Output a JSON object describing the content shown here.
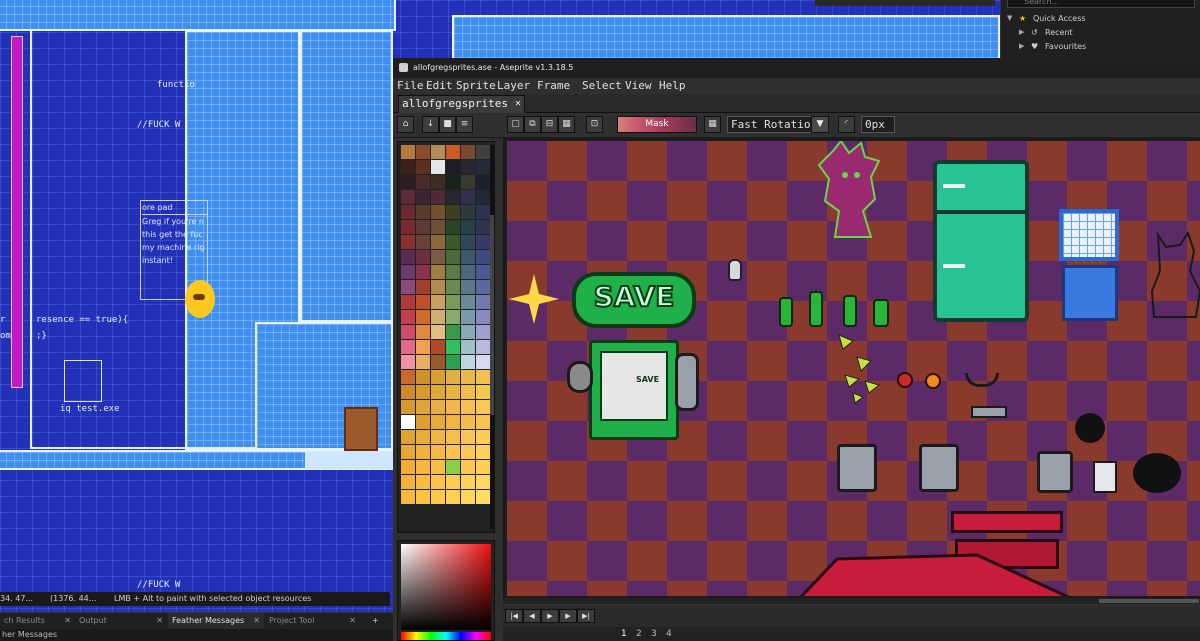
{
  "gm_room": {
    "code_fragments": [
      "functio",
      "//FUCK W",
      "resence == true){",
      ";}",
      "om",
      "r",
      "//FUCK W"
    ],
    "notepad": {
      "title": "ore pad",
      "lines": [
        "Greg if you're n",
        "this get the fuc",
        "my machine rig",
        "instant!"
      ]
    },
    "file_label": "iq test.exe",
    "colors": {
      "background": "#2231b8",
      "wall": "#3e8ff0",
      "outline": "#e8f2ff"
    }
  },
  "gm_status": {
    "coord1": "34. 47...",
    "coord2": "(1376. 44...",
    "hint": "LMB + Alt to paint with selected object resources"
  },
  "gm_tabs": [
    {
      "label": "ch Results",
      "close": "✕",
      "active": false
    },
    {
      "label": "Output",
      "close": "✕",
      "active": false
    },
    {
      "label": "Feather Messages",
      "close": "✕",
      "active": true
    },
    {
      "label": "Project Tool",
      "close": "✕",
      "active": false
    }
  ],
  "gm_tab_add": "+",
  "gm_feather_label": "her Messages",
  "gm_right": {
    "search_placeholder": "Search...",
    "items": [
      {
        "label": "Quick Access",
        "icon": "star-icon"
      },
      {
        "label": "Recent",
        "icon": "history-icon"
      },
      {
        "label": "Favourites",
        "icon": "heart-icon"
      }
    ]
  },
  "aseprite": {
    "title": "allofgregsprites.ase - Aseprite v1.3.18.5",
    "menu": [
      "File",
      "Edit",
      "Sprite",
      "Layer",
      "Frame",
      "Select",
      "View",
      "Help"
    ],
    "tab": {
      "label": "allofgregsprites",
      "close": "✕"
    },
    "toolbar": {
      "mask_label": "Mask",
      "rotation_algorithm": "Fast Rotation",
      "tolerance": "0px"
    },
    "timeline": {
      "buttons": [
        "|◀",
        "◀",
        "▶",
        "▶",
        "▶|"
      ],
      "frames": [
        "1",
        "2",
        "3",
        "4"
      ],
      "active_frame": "1"
    },
    "palette": [
      "#b37a3b",
      "#8d4b2e",
      "#b58a5c",
      "#c85c26",
      "#7a4a2c",
      "#404040",
      "#3a2016",
      "#5a3020",
      "#e6e6e6",
      "#1d1d28",
      "#2a2533",
      "#262b3c",
      "#2e1d20",
      "#4a2a2a",
      "#3c2e22",
      "#142418",
      "#3a3a30",
      "#1e2030",
      "#5a2a38",
      "#3e2430",
      "#502a34",
      "#2a2630",
      "#33304a",
      "#222a3a",
      "#6a2a2e",
      "#5a3c2c",
      "#74502c",
      "#3a4020",
      "#2a3a3e",
      "#2c3450",
      "#7a2a2c",
      "#5e3a36",
      "#6e5034",
      "#2a442a",
      "#28404a",
      "#2f3450",
      "#8a3030",
      "#6a4038",
      "#8a6a3a",
      "#3a5a2c",
      "#2e4a5a",
      "#3a3a6a",
      "#5a2a50",
      "#6a3040",
      "#7c5a48",
      "#4a6a3a",
      "#3a5a6a",
      "#3e4a80",
      "#6a3a6a",
      "#8a3050",
      "#a08040",
      "#5a7a44",
      "#4a6a7a",
      "#4a5a96",
      "#8a4a7a",
      "#a0402c",
      "#b08a50",
      "#6a8a50",
      "#5a7a8a",
      "#5a6aa0",
      "#b03a3a",
      "#c0502a",
      "#c8a060",
      "#7a9a5a",
      "#6a8a9a",
      "#707ab0",
      "#c04050",
      "#d06a30",
      "#d0b070",
      "#8aaa6a",
      "#7a9aaa",
      "#8a8ac0",
      "#d04a6a",
      "#e08a40",
      "#e0c080",
      "#3a9a4a",
      "#8aaab8",
      "#a0a0d0",
      "#e06a8a",
      "#f0a050",
      "#b04a2a",
      "#30c060",
      "#a0c0c8",
      "#b8b8e0",
      "#f090a0",
      "#e8b060",
      "#9a5a30",
      "#2aa050",
      "#c0d8e0",
      "#d8d8f0",
      "#c86a2a",
      "#d0902e",
      "#d8a030",
      "#e0b040",
      "#e8b848",
      "#f0c050",
      "#d08a2a",
      "#d89a30",
      "#e0a838",
      "#e8b440",
      "#f0be48",
      "#f4c850",
      "#d89830",
      "#e0a438",
      "#e8ae40",
      "#f0b848",
      "#f4c050",
      "#f8c858",
      "#ffffff",
      "#e0a030",
      "#e8aa38",
      "#f0b440",
      "#f4bc48",
      "#f8c450",
      "#e0a232",
      "#e8ac3a",
      "#f0b642",
      "#f4be4a",
      "#f8c652",
      "#fccc5a",
      "#e8a834",
      "#f0b23c",
      "#f4ba44",
      "#f8c24c",
      "#fcca54",
      "#ffd05c",
      "#f0ae36",
      "#f4b63e",
      "#f8be46",
      "#8ad040",
      "#fcc84e",
      "#ffce56",
      "#f4b438",
      "#f8bc40",
      "#fcc448",
      "#ffcc50",
      "#ffd258",
      "#ffd860",
      "#f8ba3a",
      "#fcc242",
      "#ffca4a",
      "#ffd052",
      "#ffd65a",
      "#ffdc62"
    ],
    "canvas_sprites": {
      "save_sign": "SAVE",
      "save_machine_label": "SAVE",
      "colors": {
        "checker_dark": "#5d2a68",
        "checker_light": "#8a3a2c",
        "fridge": "#27c394",
        "sign": "#1fb04a"
      }
    }
  }
}
